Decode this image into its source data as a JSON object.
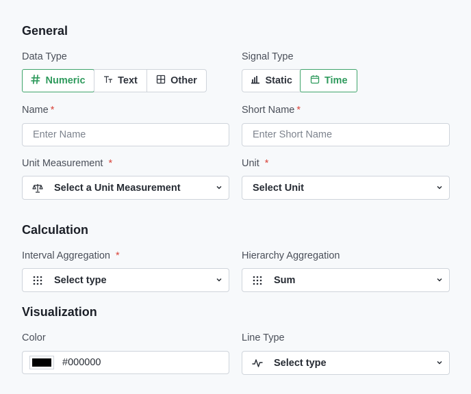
{
  "general": {
    "title": "General",
    "data_type": {
      "label": "Data Type",
      "options": [
        {
          "label": "Numeric",
          "icon": "hash-icon",
          "active": true
        },
        {
          "label": "Text",
          "icon": "text-size-icon",
          "active": false
        },
        {
          "label": "Other",
          "icon": "grid-icon",
          "active": false
        }
      ]
    },
    "signal_type": {
      "label": "Signal Type",
      "options": [
        {
          "label": "Static",
          "icon": "bar-chart-icon",
          "active": false
        },
        {
          "label": "Time",
          "icon": "calendar-icon",
          "active": true
        }
      ]
    },
    "name": {
      "label": "Name",
      "required": "*",
      "placeholder": "Enter Name",
      "value": ""
    },
    "short_name": {
      "label": "Short Name",
      "required": "*",
      "placeholder": "Enter Short Name",
      "value": ""
    },
    "unit_measurement": {
      "label": "Unit Measurement",
      "required": "*",
      "selected": "Select a Unit Measurement",
      "icon": "scale-icon"
    },
    "unit": {
      "label": "Unit",
      "required": "*",
      "selected": "Select Unit"
    }
  },
  "calculation": {
    "title": "Calculation",
    "interval_aggregation": {
      "label": "Interval Aggregation",
      "required": "*",
      "selected": "Select type",
      "icon": "dots-grid-icon"
    },
    "hierarchy_aggregation": {
      "label": "Hierarchy Aggregation",
      "selected": "Sum",
      "icon": "dots-grid-icon"
    }
  },
  "visualization": {
    "title": "Visualization",
    "color": {
      "label": "Color",
      "value": "#000000",
      "swatch": "#000000"
    },
    "line_type": {
      "label": "Line Type",
      "selected": "Select type",
      "icon": "line-chart-icon"
    }
  },
  "colors": {
    "accent": "#2e9a5c",
    "required": "#d9453b",
    "border": "#cfd4db"
  }
}
